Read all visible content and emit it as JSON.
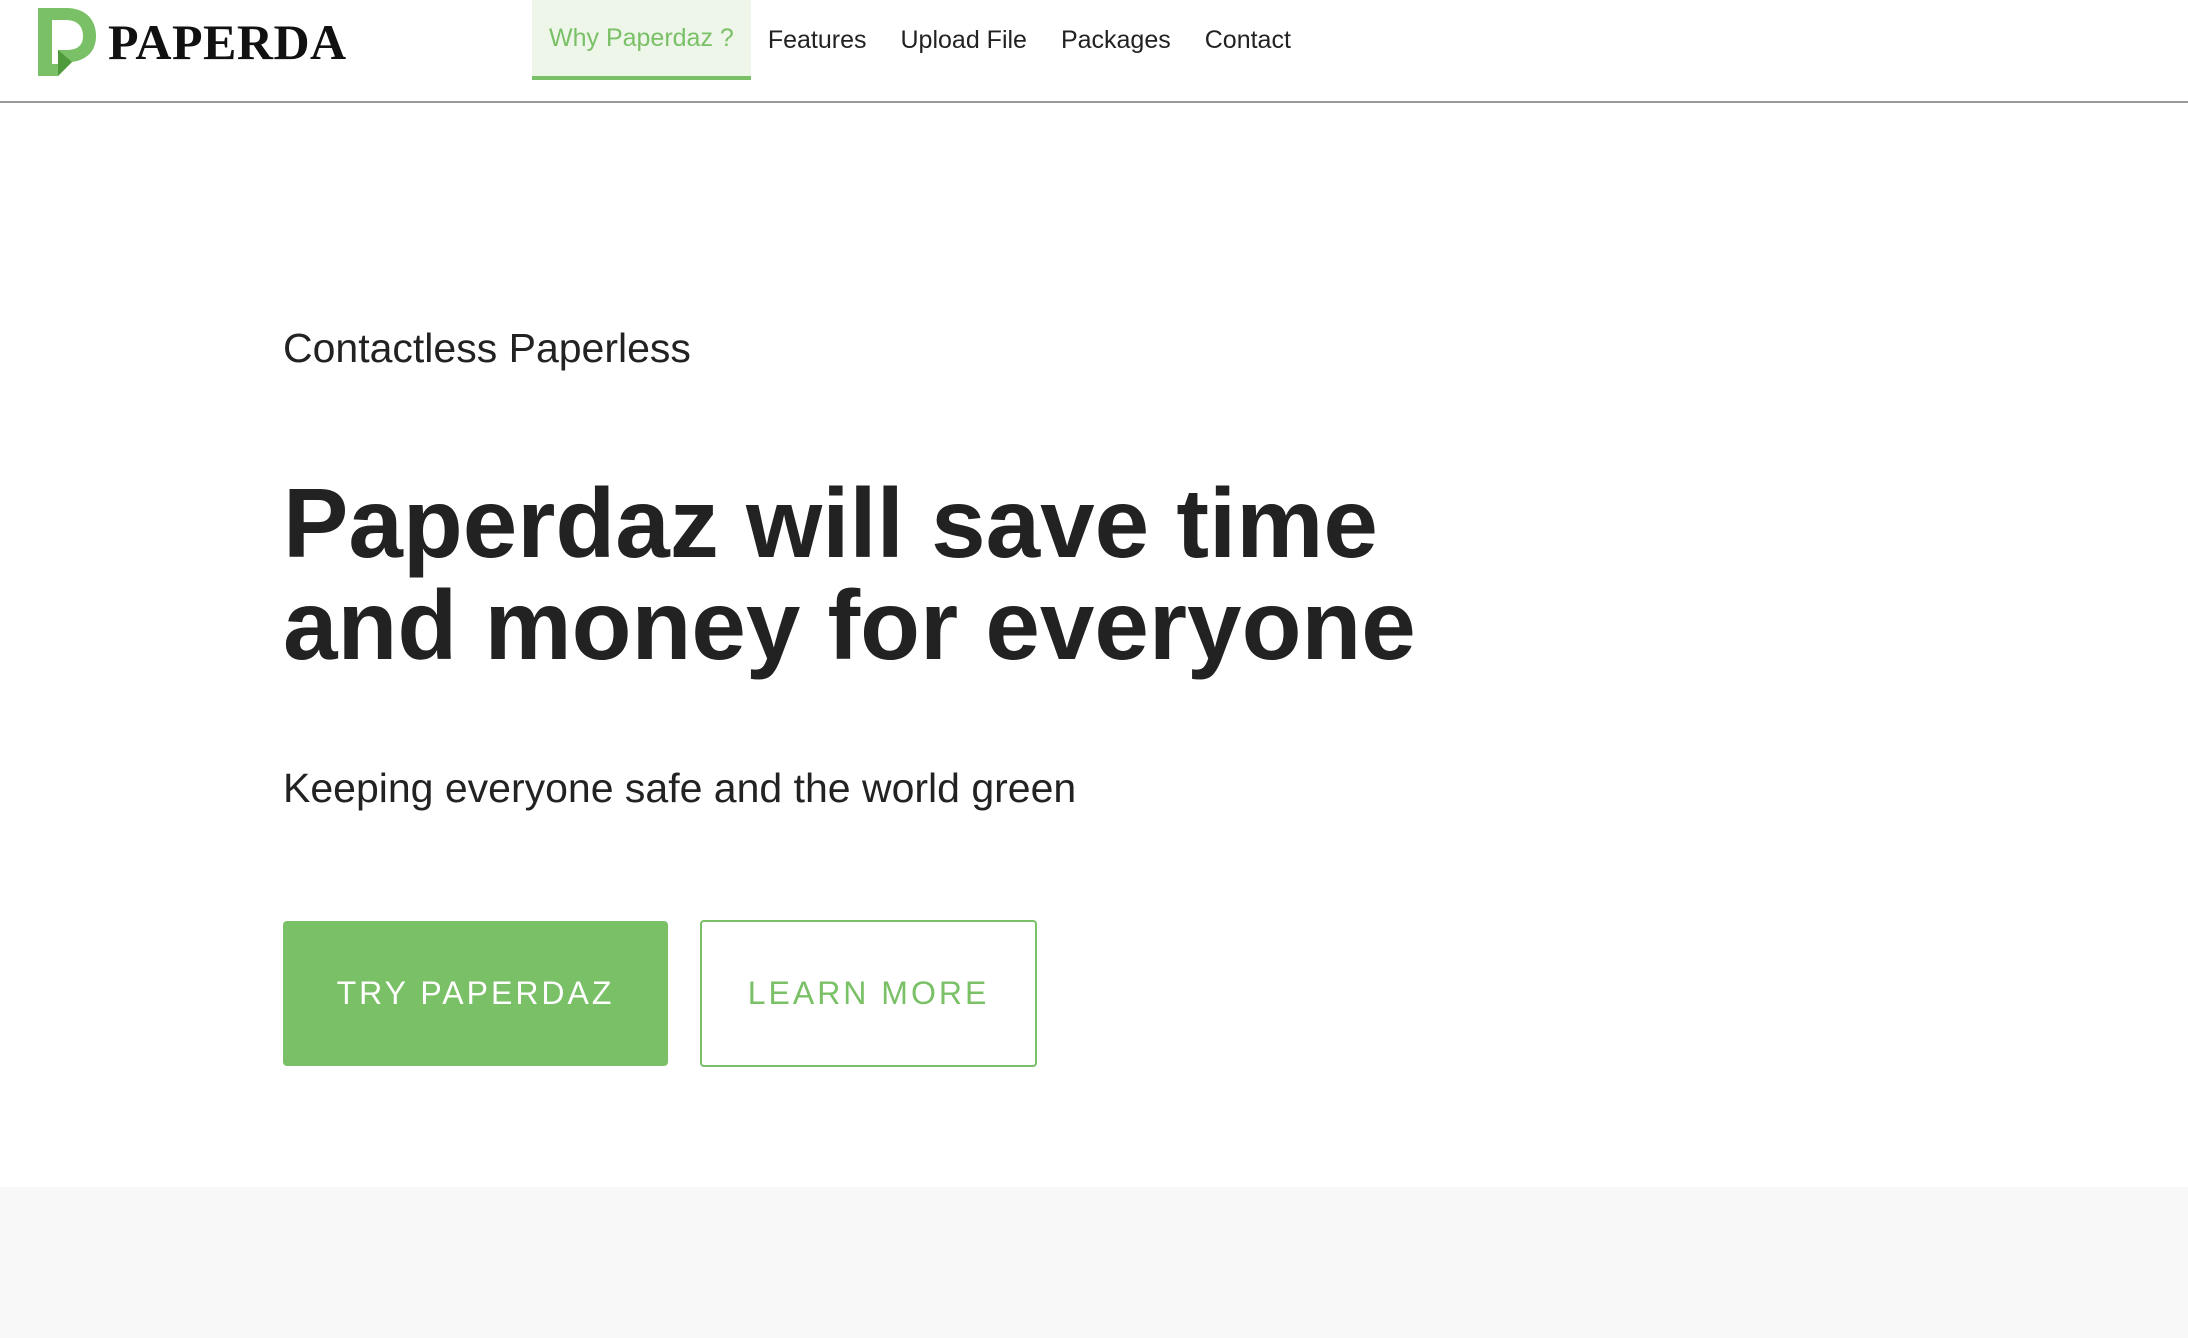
{
  "header": {
    "logo_text": "PAPERDAZ",
    "nav": [
      {
        "label": "Why Paperdaz ?",
        "active": true
      },
      {
        "label": "Features",
        "active": false
      },
      {
        "label": "Upload File",
        "active": false
      },
      {
        "label": "Packages",
        "active": false
      },
      {
        "label": "Contact",
        "active": false
      }
    ]
  },
  "hero": {
    "eyebrow": "Contactless Paperless",
    "headline_line1": "Paperdaz will save time",
    "headline_line2": "and money for everyone",
    "subline": "Keeping everyone safe and the world green",
    "primary_button": "TRY PAPERDAZ",
    "secondary_button": "LEARN MORE"
  },
  "colors": {
    "brand_green": "#79c066",
    "text": "#222222",
    "active_tab_bg": "#eef6ea",
    "band_bg": "#f8f8f8"
  },
  "icons": {
    "logo": "paperdaz-logo-icon"
  }
}
